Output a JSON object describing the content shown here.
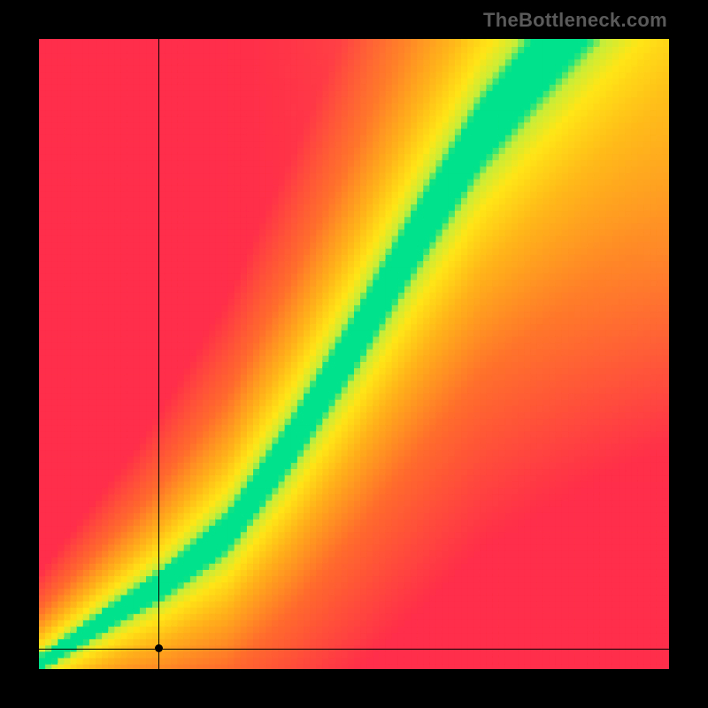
{
  "watermark": "TheBottleneck.com",
  "chart_data": {
    "type": "heatmap",
    "title": "",
    "xlabel": "",
    "ylabel": "",
    "xlim": [
      0,
      100
    ],
    "ylim": [
      0,
      100
    ],
    "grid": false,
    "legend": false,
    "ridge": {
      "description": "Green optimal-pairing ridge y = f(x), piecewise linear in normalized [0,100] space",
      "points": [
        {
          "x": 0,
          "y": 1
        },
        {
          "x": 6,
          "y": 5
        },
        {
          "x": 12,
          "y": 9
        },
        {
          "x": 20,
          "y": 14
        },
        {
          "x": 30,
          "y": 22
        },
        {
          "x": 40,
          "y": 36
        },
        {
          "x": 50,
          "y": 52
        },
        {
          "x": 60,
          "y": 69
        },
        {
          "x": 70,
          "y": 85
        },
        {
          "x": 80,
          "y": 97
        },
        {
          "x": 100,
          "y": 120
        }
      ],
      "half_width": {
        "description": "approximate half-width of green band in y-units as function of x",
        "points": [
          {
            "x": 0,
            "w": 1.2
          },
          {
            "x": 15,
            "w": 2.0
          },
          {
            "x": 35,
            "w": 3.5
          },
          {
            "x": 60,
            "w": 5.0
          },
          {
            "x": 100,
            "w": 7.0
          }
        ]
      }
    },
    "corner_bias": {
      "description": "Yellow hue lift toward upper-right corner (on-screen), i.e. high-x / high-y region",
      "strength": 0.7
    },
    "color_stops": {
      "description": "distance-to-ridge -> color gradient, distance in band-half-width units",
      "stops": [
        {
          "d": 0.0,
          "color": "#00E28C"
        },
        {
          "d": 0.85,
          "color": "#00E28C"
        },
        {
          "d": 1.3,
          "color": "#C6EE3A"
        },
        {
          "d": 2.2,
          "color": "#FFE617"
        },
        {
          "d": 4.0,
          "color": "#FFB21A"
        },
        {
          "d": 7.0,
          "color": "#FF6B2D"
        },
        {
          "d": 12.0,
          "color": "#FF2E4A"
        },
        {
          "d": 30.0,
          "color": "#FF2E4A"
        }
      ]
    },
    "crosshair": {
      "x": 19,
      "y": 3.3
    },
    "pixel_resolution": 100
  }
}
